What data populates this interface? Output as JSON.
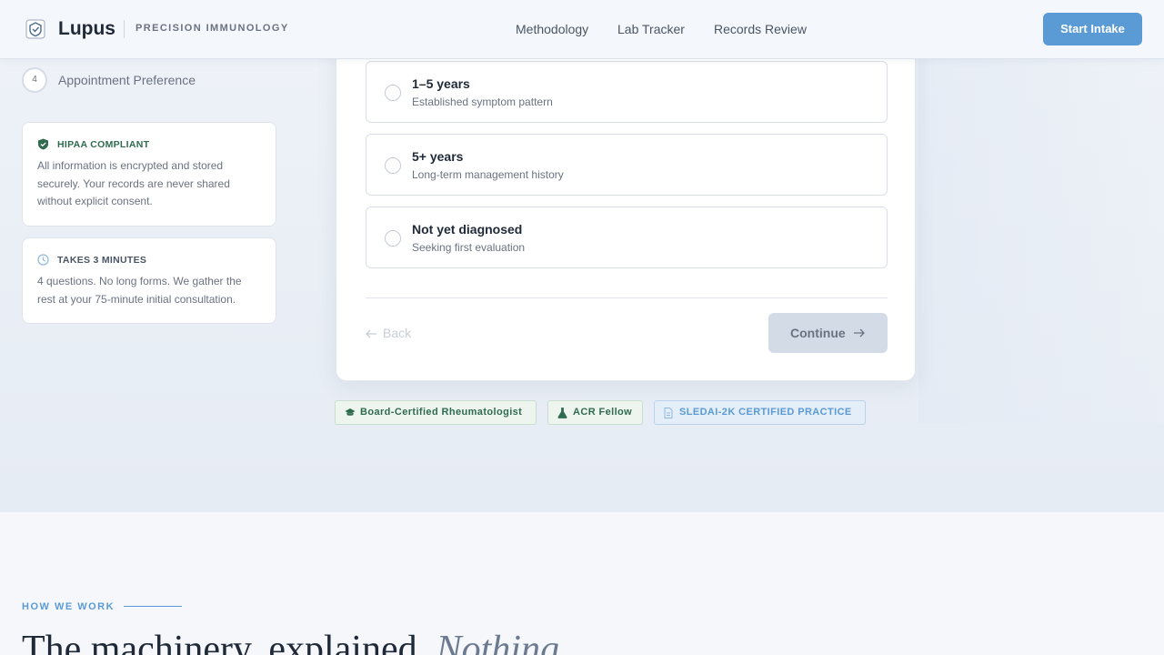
{
  "header": {
    "brand": "Lupus",
    "tagline": "PRECISION IMMUNOLOGY",
    "nav": [
      "Methodology",
      "Lab Tracker",
      "Records Review"
    ],
    "cta": "Start Intake"
  },
  "steps": {
    "current_number": "4",
    "current_label": "Appointment Preference"
  },
  "info_cards": [
    {
      "icon": "shield-check-icon",
      "title": "HIPAA COMPLIANT",
      "text": "All information is encrypted and stored securely. Your records are never shared without explicit consent.",
      "color": "#2f6b4f"
    },
    {
      "icon": "clock-icon",
      "title": "TAKES 3 MINUTES",
      "text": "4 questions. No long forms. We gather the rest at your 75-minute initial consultation.",
      "color": "#4b5563"
    }
  ],
  "options": [
    {
      "title": "1–5 years",
      "subtitle": "Established symptom pattern"
    },
    {
      "title": "5+ years",
      "subtitle": "Long-term management history"
    },
    {
      "title": "Not yet diagnosed",
      "subtitle": "Seeking first evaluation"
    }
  ],
  "form_nav": {
    "back": "Back",
    "continue": "Continue"
  },
  "badges": [
    {
      "label": "Board-Certified Rheumatologist",
      "icon": "graduation-cap-icon",
      "color": "#2f6b4f"
    },
    {
      "label": "ACR Fellow",
      "icon": "flask-icon",
      "color": "#2f6b4f"
    },
    {
      "label": "SLEDAI-2K CERTIFIED PRACTICE",
      "icon": "document-icon",
      "color": "#5b9bd5"
    }
  ],
  "section": {
    "eyebrow": "HOW WE WORK",
    "headline": "The machinery, explained.",
    "headline_em": "Nothing"
  },
  "colors": {
    "accent": "#5b9bd5",
    "success": "#2f6b4f"
  }
}
